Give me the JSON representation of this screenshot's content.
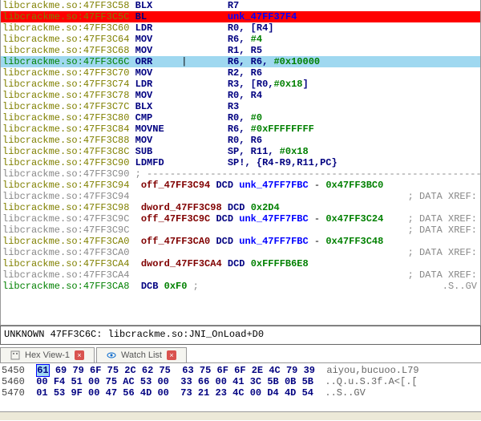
{
  "lines": [
    {
      "bg": "",
      "addr": "libcrackme.so:47FF3C58 ",
      "cls": "addr",
      "mn": "BLX",
      "ops": [
        {
          "t": "R7",
          "c": "reg"
        }
      ]
    },
    {
      "bg": "bg-red",
      "addr": "libcrackme.so:47FF3C5C ",
      "cls": "addr",
      "mn": "BL",
      "ops": [
        {
          "t": "unk_47FF37F4",
          "c": "sym-blue"
        }
      ]
    },
    {
      "bg": "",
      "addr": "libcrackme.so:47FF3C60 ",
      "cls": "addr",
      "mn": "LDR",
      "ops": [
        {
          "t": "R0, [R4]",
          "c": "reg"
        }
      ]
    },
    {
      "bg": "",
      "addr": "libcrackme.so:47FF3C64 ",
      "cls": "addr",
      "mn": "MOV",
      "ops": [
        {
          "t": "R6, ",
          "c": "reg"
        },
        {
          "t": "#4",
          "c": "num-green"
        }
      ]
    },
    {
      "bg": "",
      "addr": "libcrackme.so:47FF3C68 ",
      "cls": "addr",
      "mn": "MOV",
      "ops": [
        {
          "t": "R1, R5",
          "c": "reg"
        }
      ]
    },
    {
      "bg": "bg-cyan",
      "addr": "libcrackme.so:47FF3C6C ",
      "cls": "addr-green",
      "mn": "ORR",
      "curs": "|",
      "ops": [
        {
          "t": "R6, R6, ",
          "c": "reg"
        },
        {
          "t": "#0x10000",
          "c": "num-green"
        }
      ]
    },
    {
      "bg": "",
      "addr": "libcrackme.so:47FF3C70 ",
      "cls": "addr",
      "mn": "MOV",
      "ops": [
        {
          "t": "R2, R6",
          "c": "reg"
        }
      ]
    },
    {
      "bg": "",
      "addr": "libcrackme.so:47FF3C74 ",
      "cls": "addr",
      "mn": "LDR",
      "ops": [
        {
          "t": "R3, [R0,",
          "c": "reg"
        },
        {
          "t": "#0x18",
          "c": "num-green"
        },
        {
          "t": "]",
          "c": "reg"
        }
      ]
    },
    {
      "bg": "",
      "addr": "libcrackme.so:47FF3C78 ",
      "cls": "addr",
      "mn": "MOV",
      "ops": [
        {
          "t": "R0, R4",
          "c": "reg"
        }
      ]
    },
    {
      "bg": "",
      "addr": "libcrackme.so:47FF3C7C ",
      "cls": "addr",
      "mn": "BLX",
      "ops": [
        {
          "t": "R3",
          "c": "reg"
        }
      ]
    },
    {
      "bg": "",
      "addr": "libcrackme.so:47FF3C80 ",
      "cls": "addr",
      "mn": "CMP",
      "ops": [
        {
          "t": "R0, ",
          "c": "reg"
        },
        {
          "t": "#0",
          "c": "num-green"
        }
      ]
    },
    {
      "bg": "",
      "addr": "libcrackme.so:47FF3C84 ",
      "cls": "addr",
      "mn": "MOVNE",
      "ops": [
        {
          "t": "R6, ",
          "c": "reg"
        },
        {
          "t": "#0xFFFFFFFF",
          "c": "num-green"
        }
      ]
    },
    {
      "bg": "",
      "addr": "libcrackme.so:47FF3C88 ",
      "cls": "addr",
      "mn": "MOV",
      "ops": [
        {
          "t": "R0, R6",
          "c": "reg"
        }
      ]
    },
    {
      "bg": "",
      "addr": "libcrackme.so:47FF3C8C ",
      "cls": "addr",
      "mn": "SUB",
      "ops": [
        {
          "t": "SP, R11, ",
          "c": "reg"
        },
        {
          "t": "#0x18",
          "c": "num-green"
        }
      ]
    },
    {
      "bg": "",
      "addr": "libcrackme.so:47FF3C90 ",
      "cls": "addr",
      "mn": "LDMFD",
      "ops": [
        {
          "t": "SP!, {R4-R9,R11,PC}",
          "c": "reg"
        }
      ]
    },
    {
      "bg": "",
      "addr": "libcrackme.so:47FF3C90 ",
      "cls": "addr-gray",
      "raw": "; ---------------------------------------------------------------------------",
      "rawc": "comment"
    },
    {
      "bg": "",
      "addr": "libcrackme.so:47FF3C94 ",
      "cls": "addr",
      "rawparts": [
        {
          "t": "off_47FF3C94 ",
          "c": "imm-red"
        },
        {
          "t": "DCD ",
          "c": "mnemonic"
        },
        {
          "t": "unk_47FF7FBC",
          "c": "sym-blue"
        },
        {
          "t": " - ",
          "c": "plain"
        },
        {
          "t": "0x47FF3BC0",
          "c": "num-green"
        }
      ]
    },
    {
      "bg": "",
      "addr": "libcrackme.so:47FF3C94 ",
      "cls": "addr-gray",
      "tail": "; DATA XREF:"
    },
    {
      "bg": "",
      "addr": "libcrackme.so:47FF3C98 ",
      "cls": "addr",
      "rawparts": [
        {
          "t": "dword_47FF3C98 ",
          "c": "imm-red"
        },
        {
          "t": "DCD ",
          "c": "mnemonic"
        },
        {
          "t": "0x2D4",
          "c": "num-green"
        }
      ]
    },
    {
      "bg": "",
      "addr": "libcrackme.so:47FF3C9C ",
      "cls": "addr-gray",
      "rawparts": [
        {
          "t": "off_47FF3C9C ",
          "c": "imm-red"
        },
        {
          "t": "DCD ",
          "c": "mnemonic"
        },
        {
          "t": "unk_47FF7FBC",
          "c": "sym-blue"
        },
        {
          "t": " - ",
          "c": "plain"
        },
        {
          "t": "0x47FF3C24",
          "c": "num-green"
        }
      ],
      "tail": "; DATA XREF:"
    },
    {
      "bg": "",
      "addr": "libcrackme.so:47FF3C9C ",
      "cls": "addr-gray",
      "tail": "; DATA XREF:"
    },
    {
      "bg": "",
      "addr": "libcrackme.so:47FF3CA0 ",
      "cls": "addr",
      "rawparts": [
        {
          "t": "off_47FF3CA0 ",
          "c": "imm-red"
        },
        {
          "t": "DCD ",
          "c": "mnemonic"
        },
        {
          "t": "unk_47FF7FBC",
          "c": "sym-blue"
        },
        {
          "t": " - ",
          "c": "plain"
        },
        {
          "t": "0x47FF3C48",
          "c": "num-green"
        }
      ]
    },
    {
      "bg": "",
      "addr": "libcrackme.so:47FF3CA0 ",
      "cls": "addr-gray",
      "tail": "; DATA XREF:"
    },
    {
      "bg": "",
      "addr": "libcrackme.so:47FF3CA4 ",
      "cls": "addr",
      "rawparts": [
        {
          "t": "dword_47FF3CA4 ",
          "c": "imm-red"
        },
        {
          "t": "DCD ",
          "c": "mnemonic"
        },
        {
          "t": "0xFFFFB6E8",
          "c": "num-green"
        }
      ]
    },
    {
      "bg": "",
      "addr": "libcrackme.so:47FF3CA4 ",
      "cls": "addr-gray",
      "tail": "; DATA XREF:"
    },
    {
      "bg": "",
      "addr": "libcrackme.so:47FF3CA8 ",
      "cls": "addr-green",
      "rawparts": [
        {
          "t": "DCB ",
          "c": "mnemonic"
        },
        {
          "t": "0xF0",
          "c": "num-green"
        },
        {
          "t": " ;",
          "c": "comment"
        }
      ],
      "tail": ".S..GV"
    }
  ],
  "status": "UNKNOWN 47FF3C6C: libcrackme.so:JNI_OnLoad+D0",
  "tabs": {
    "hex": "Hex View-1",
    "watch": "Watch List"
  },
  "hex": [
    {
      "a": "5450",
      "b": [
        "61",
        "69",
        "79",
        "6F",
        "75",
        "2C",
        "62",
        "75",
        "63",
        "75",
        "6F",
        "6F",
        "2E",
        "4C",
        "79",
        "39",
        "aiyou,bucuoo.L79"
      ],
      "hl": 0
    },
    {
      "a": "5460",
      "b": [
        "00",
        "F4",
        "51",
        "00",
        "75",
        "AC",
        "53",
        "00",
        "33",
        "66",
        "00",
        "41",
        "3C",
        "5B",
        "0B",
        "5B",
        "..Q.u.S.3f.A<[.["
      ],
      "hl": -1
    },
    {
      "a": "5470",
      "b": [
        "01",
        "53",
        "9F",
        "00",
        "47",
        "56",
        "4D",
        "00",
        "73",
        "21",
        "23",
        "4C",
        "00",
        "D4",
        "4D",
        "54",
        "..S..GV"
      ],
      "hl": -1
    }
  ]
}
